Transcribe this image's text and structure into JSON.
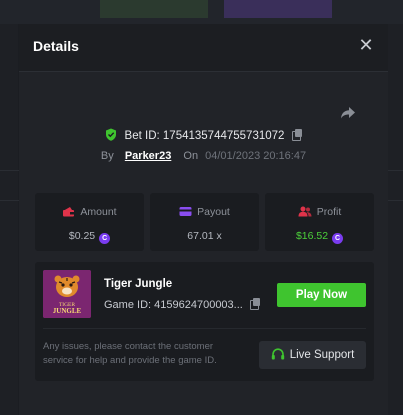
{
  "modal": {
    "title": "Details",
    "close_icon": "close-icon",
    "share_icon": "share-icon"
  },
  "bet": {
    "id_label": "Bet ID:",
    "id_value": "1754135744755731072",
    "by_label": "By",
    "username": "Parker23",
    "on_label": "On",
    "datetime": "04/01/2023 20:16:47"
  },
  "stats": {
    "amount": {
      "label": "Amount",
      "value": "$0.25",
      "icon": "wallet-icon"
    },
    "payout": {
      "label": "Payout",
      "value": "67.01 x",
      "icon": "card-icon"
    },
    "profit": {
      "label": "Profit",
      "value": "$16.52",
      "icon": "users-icon"
    }
  },
  "game": {
    "name": "Tiger Jungle",
    "id_label": "Game ID:",
    "id_value": "4159624700003...",
    "play_label": "Play Now",
    "thumb_text_top": "TIGER",
    "thumb_text_bottom": "JUNGLE"
  },
  "support": {
    "note": "Any issues, please contact the customer service for help and provide the game ID.",
    "button_label": "Live Support"
  },
  "colors": {
    "accent_green": "#3fc42f",
    "profit_green": "#4cd13a",
    "coin_purple": "#7a3cf0",
    "icon_red": "#e0334a",
    "icon_purple": "#8a4df0"
  }
}
